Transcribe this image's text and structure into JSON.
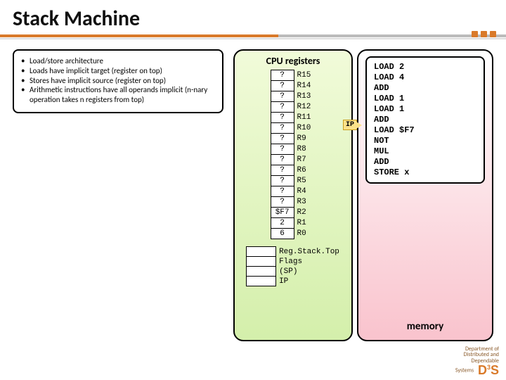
{
  "title": "Stack Machine",
  "bullets": [
    "Load/store architecture",
    "Loads have implicit target (register on top)",
    "Stores have implicit source (register on top)",
    "Arithmetic instructions have all operands implicit (n-nary operation takes n registers from top)"
  ],
  "cpu": {
    "heading": "CPU registers",
    "registers": [
      {
        "val": "?",
        "name": "R15"
      },
      {
        "val": "?",
        "name": "R14"
      },
      {
        "val": "?",
        "name": "R13"
      },
      {
        "val": "?",
        "name": "R12"
      },
      {
        "val": "?",
        "name": "R11"
      },
      {
        "val": "?",
        "name": "R10"
      },
      {
        "val": "?",
        "name": "R9"
      },
      {
        "val": "?",
        "name": "R8"
      },
      {
        "val": "?",
        "name": "R7"
      },
      {
        "val": "?",
        "name": "R6"
      },
      {
        "val": "?",
        "name": "R5"
      },
      {
        "val": "?",
        "name": "R4"
      },
      {
        "val": "?",
        "name": "R3"
      },
      {
        "val": "$F7",
        "name": "R2"
      },
      {
        "val": "2",
        "name": "R1"
      },
      {
        "val": "6",
        "name": "R0"
      }
    ],
    "extra": [
      "Reg.Stack.Top",
      "Flags",
      "(SP)",
      "IP"
    ]
  },
  "memory": {
    "label": "memory",
    "code": [
      "LOAD 2",
      "LOAD 4",
      "ADD",
      "LOAD 1",
      "LOAD 1",
      "ADD",
      "LOAD $F7",
      "NOT",
      "MUL",
      "ADD",
      "STORE x"
    ]
  },
  "ip_label": "IP",
  "footer": {
    "line1": "Department of",
    "line2": "Distributed and",
    "line3": "Dependable",
    "line4": "Systems",
    "logo": "D3S"
  }
}
